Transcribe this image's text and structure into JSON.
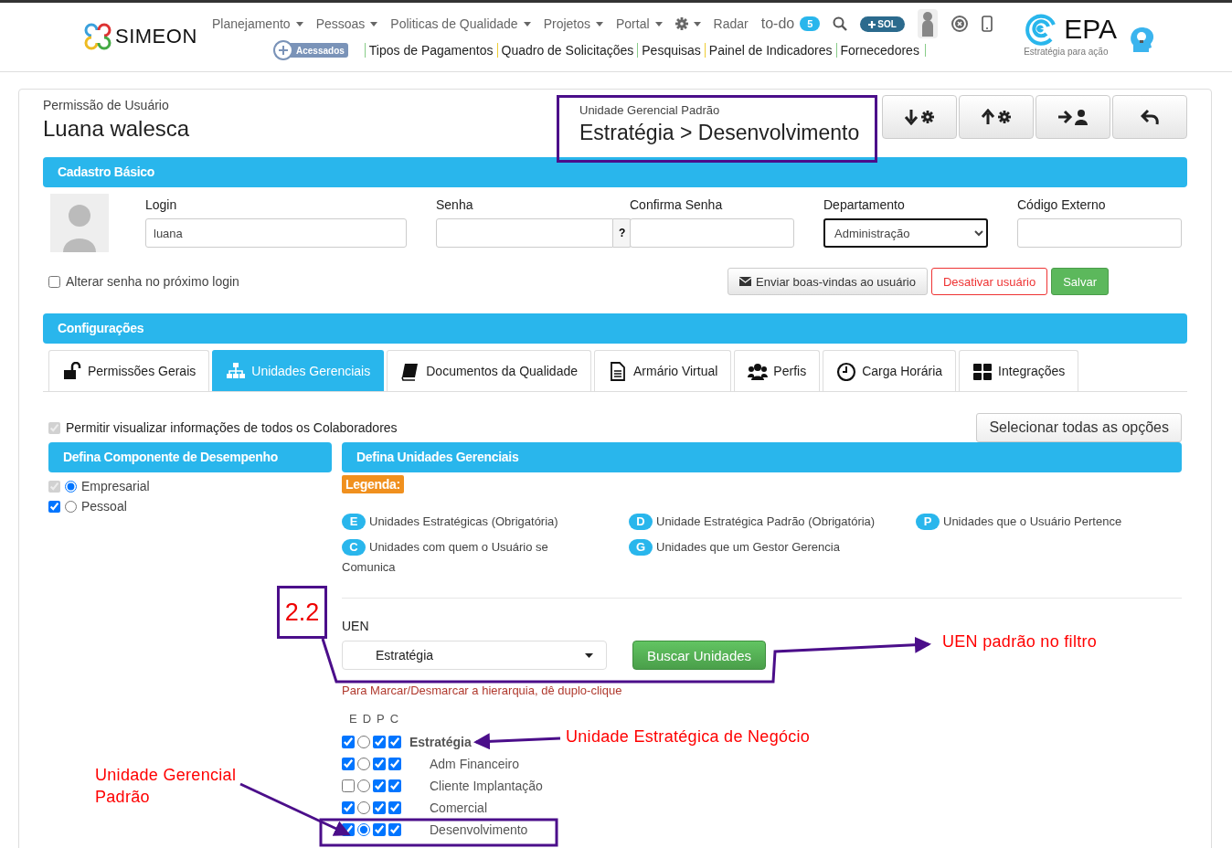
{
  "header": {
    "logo": "SIMEON",
    "nav": [
      {
        "kind": "menu",
        "label": "Planejamento"
      },
      {
        "kind": "menu",
        "label": "Pessoas"
      },
      {
        "kind": "menu",
        "label": "Politicas de Qualidade"
      },
      {
        "kind": "menu",
        "label": "Projetos"
      },
      {
        "kind": "menu",
        "label": "Portal"
      },
      {
        "kind": "settings"
      },
      {
        "kind": "link",
        "label": "Radar"
      },
      {
        "kind": "todo",
        "label": "to-do",
        "count": "5"
      }
    ],
    "sol_button": "SOL",
    "accessed_button": "Acessados",
    "quick_links": [
      "Tipos de Pagamentos",
      "Quadro de Solicitações",
      "Pesquisas",
      "Painel de Indicadores",
      "Fornecedores"
    ],
    "brand": {
      "name": "EPA",
      "tagline": "Estratégia para ação"
    }
  },
  "page": {
    "caption": "Permissão de Usuário",
    "user_name": "Luana walesca",
    "default_unit": {
      "label": "Unidade Gerencial Padrão",
      "value": "Estratégia > Desenvolvimento"
    }
  },
  "basic": {
    "title": "Cadastro Básico",
    "fields": [
      {
        "kind": "text",
        "label": "Login",
        "value": "luana"
      },
      {
        "kind": "help",
        "label": "Senha",
        "button": "?"
      },
      {
        "kind": "text",
        "label": "Confirma Senha"
      },
      {
        "kind": "select",
        "label": "Departamento",
        "value": "Administração"
      },
      {
        "kind": "text",
        "label": "Código Externo"
      }
    ],
    "change_password": {
      "label": "Alterar senha no próximo login",
      "checked": false
    },
    "buttons": [
      {
        "kind": "mail",
        "label": "Enviar boas-vindas ao usuário"
      },
      {
        "kind": "danger",
        "label": "Desativar usuário"
      },
      {
        "kind": "success",
        "label": "Salvar"
      }
    ]
  },
  "config": {
    "title": "Configurações",
    "tabs": [
      {
        "kind": "lock",
        "label": "Permissões Gerais",
        "selected": false
      },
      {
        "kind": "sitemap",
        "label": "Unidades Gerenciais",
        "selected": true
      },
      {
        "kind": "book",
        "label": "Documentos da Qualidade",
        "selected": false
      },
      {
        "kind": "file",
        "label": "Armário Virtual",
        "selected": false
      },
      {
        "kind": "users",
        "label": "Perfis",
        "selected": false
      },
      {
        "kind": "clock",
        "label": "Carga Horária",
        "selected": false
      },
      {
        "kind": "grid",
        "label": "Integrações",
        "selected": false
      }
    ],
    "allow_all": {
      "label": "Permitir visualizar informações de todos os Colaboradores",
      "checked": true,
      "disabled": true
    },
    "select_all": "Selecionar todas as opções",
    "performance": {
      "title": "Defina Componente de Desempenho",
      "items": [
        {
          "label": "Empresarial",
          "checked": true,
          "disabled": true,
          "selected": true
        },
        {
          "label": "Pessoal",
          "checked": true,
          "disabled": false,
          "selected": false
        }
      ]
    },
    "units": {
      "title": "Defina Unidades Gerenciais",
      "legend_title": "Legenda:",
      "legend": [
        {
          "letter": "E",
          "text": "Unidades Estratégicas (Obrigatória)"
        },
        {
          "letter": "D",
          "text": "Unidade Estratégica Padrão (Obrigatória)"
        },
        {
          "letter": "P",
          "text": "Unidades que o Usuário Pertence"
        },
        {
          "letter": "C",
          "text": "Unidades com quem o Usuário se Comunica"
        },
        {
          "letter": "G",
          "text": "Unidades que um Gestor Gerencia"
        }
      ],
      "uen_label": "UEN",
      "uen_value": "Estratégia",
      "search_button": "Buscar Unidades",
      "hint": "Para Marcar/Desmarcar a hierarquia, dê duplo-clique",
      "columns": [
        "E",
        "D",
        "P",
        "C"
      ],
      "tree": [
        {
          "name": "Estratégia",
          "e": true,
          "d": false,
          "p": true,
          "c": true,
          "children": [
            {
              "name": "Adm Financeiro",
              "e": true,
              "d": false,
              "p": true,
              "c": true
            },
            {
              "name": "Cliente Implantação",
              "e": false,
              "d": false,
              "p": true,
              "c": true
            },
            {
              "name": "Comercial",
              "e": true,
              "d": false,
              "p": true,
              "c": true
            },
            {
              "name": "Desenvolvimento",
              "e": true,
              "d": true,
              "p": true,
              "c": true
            }
          ]
        }
      ]
    }
  },
  "annotations": [
    "2.2",
    "UEN padrão no filtro",
    "Unidade Estratégica de Negócio",
    "Unidade Gerencial Padrão"
  ]
}
